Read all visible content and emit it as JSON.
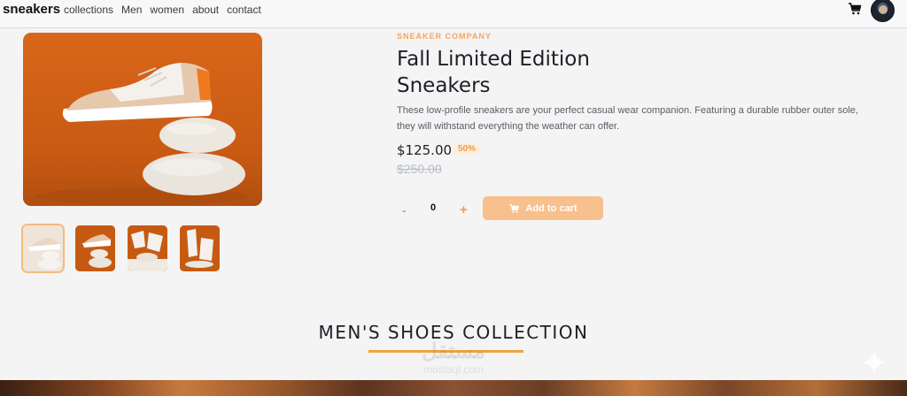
{
  "nav": {
    "brand": "sneakers",
    "links": [
      "collections",
      "Men",
      "women",
      "about",
      "contact"
    ],
    "icons": {
      "cart": "cart-icon",
      "avatar": "avatar"
    }
  },
  "product": {
    "company": "SNEAKER COMPANY",
    "title_line1": "Fall Limited Edition",
    "title_line2": "Sneakers",
    "description": "These low-profile sneakers are your perfect casual wear companion. Featuring a durable rubber outer sole, they will withstand everything the weather can offer.",
    "price": "$125.00",
    "discount": "50%",
    "old_price": "$250.00",
    "quantity": "0",
    "minus_label": "-",
    "plus_label": "+",
    "add_to_cart": "Add to cart"
  },
  "gallery": {
    "thumbnail_count": 4,
    "active_thumbnail": 1
  },
  "section": {
    "title": "MEN'S SHOES COLLECTION"
  },
  "watermark": {
    "arabic": "مستقل",
    "latin": "mostaql.com"
  },
  "colors": {
    "accent": "#f29a45",
    "accent_light": "#f7c08d",
    "hero_bg": "#c85a12",
    "text_dark": "#1d2026"
  }
}
